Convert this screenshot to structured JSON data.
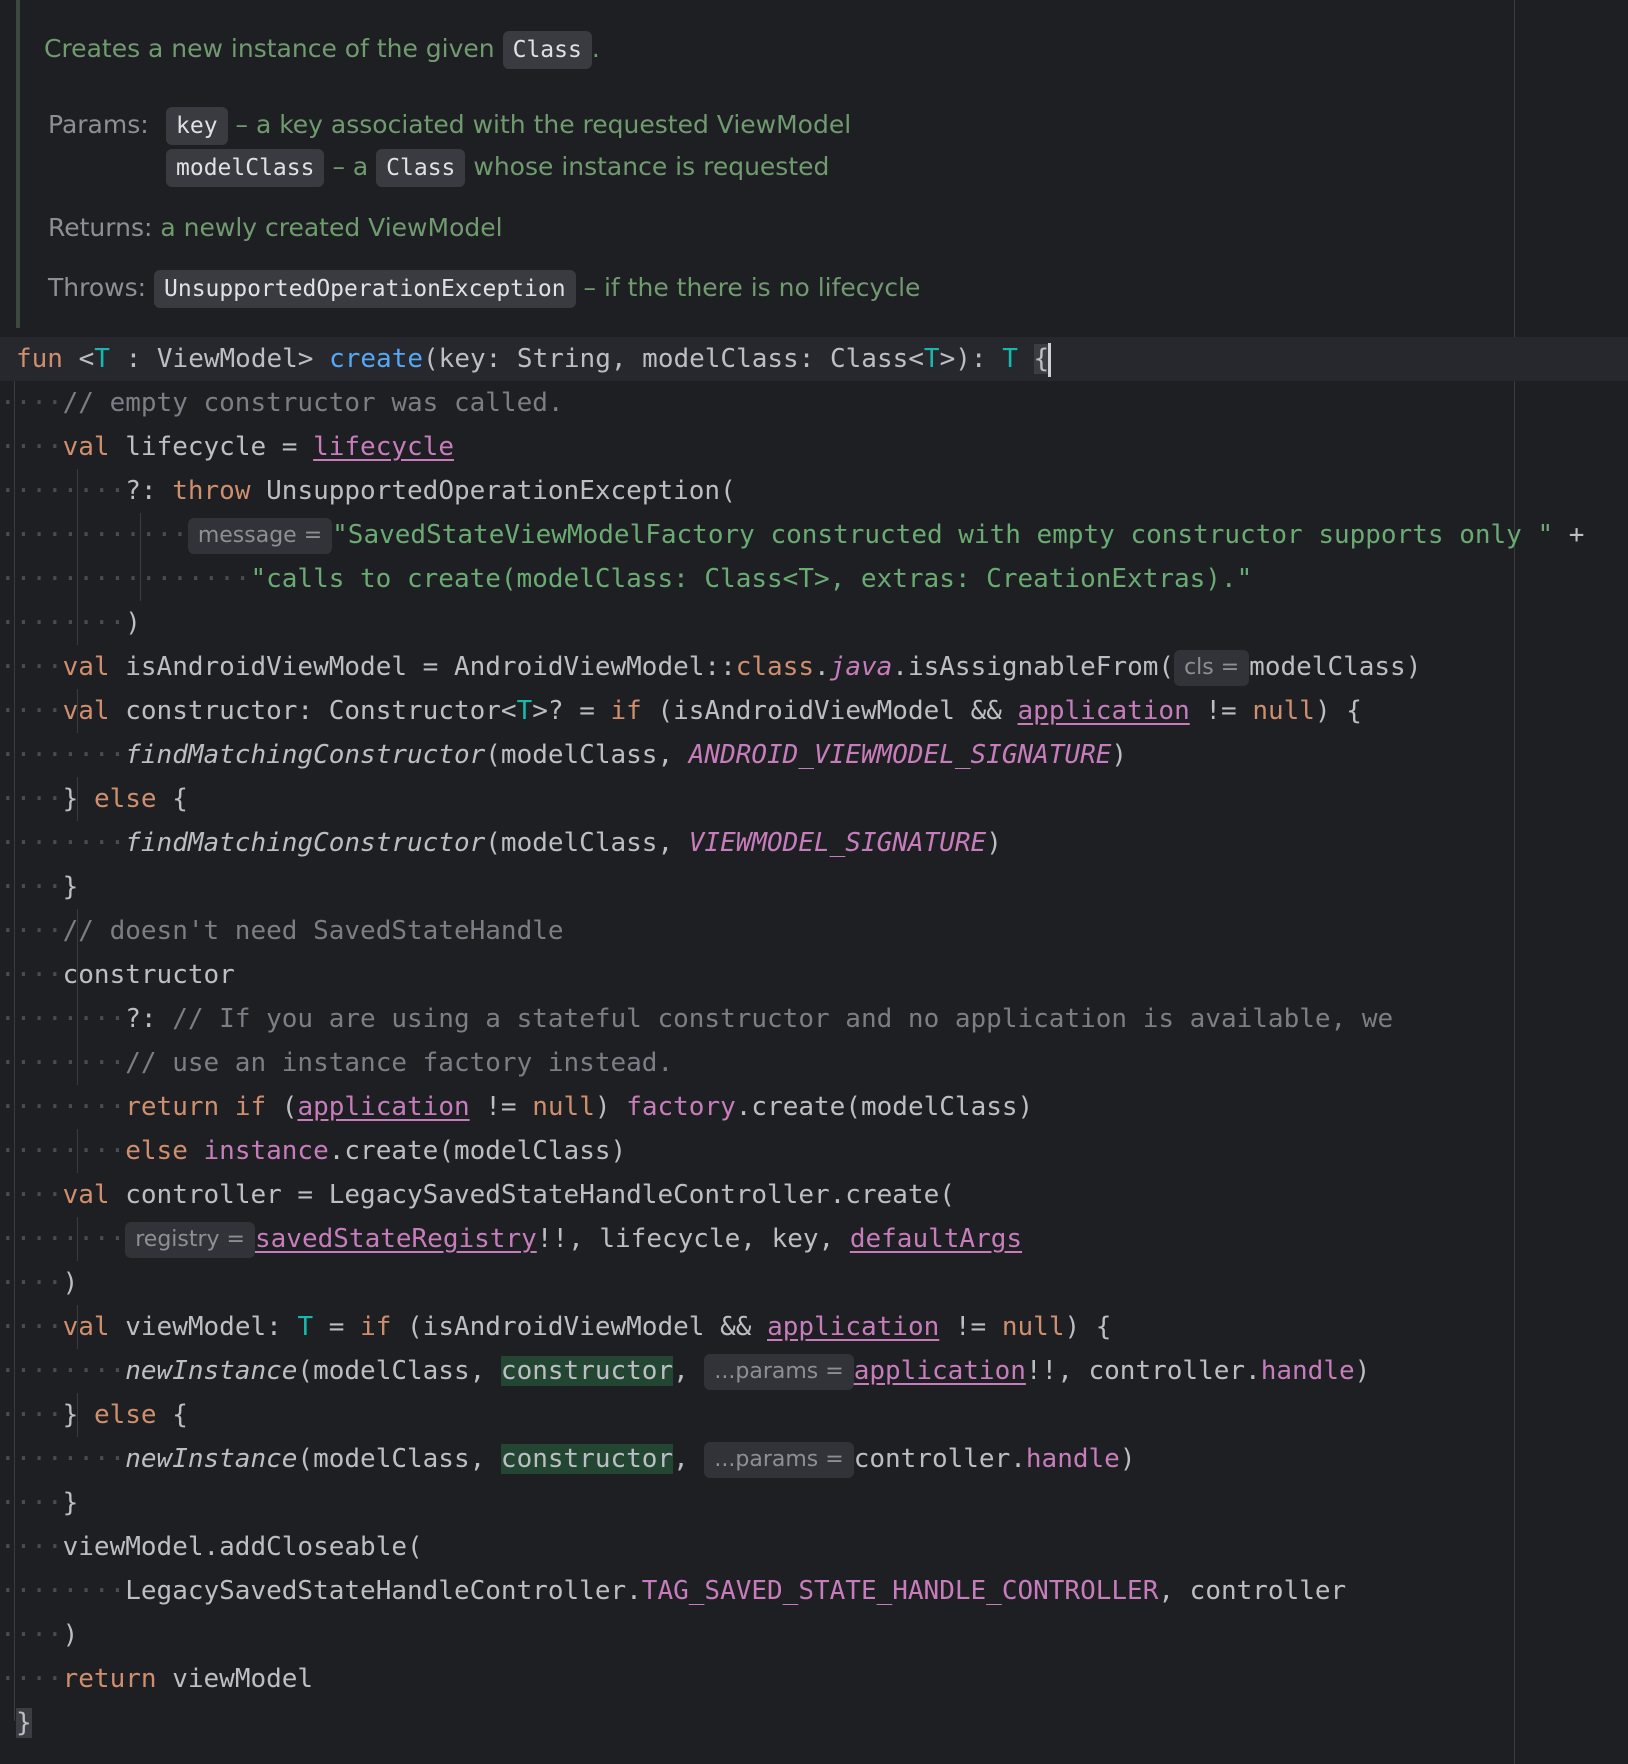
{
  "doc": {
    "summary_text": "Creates a new instance of the given",
    "summary_code": "Class",
    "summary_end": ".",
    "params_label": "Params:",
    "param1_name": "key",
    "param1_desc": "– a key associated with the requested ViewModel",
    "param2_name": "modelClass",
    "param2_mid": "– a",
    "param2_code": "Class",
    "param2_desc": "whose instance is requested",
    "returns_label": "Returns:",
    "returns_desc": "a newly created ViewModel",
    "throws_label": "Throws:",
    "throws_name": "UnsupportedOperationException",
    "throws_desc": "– if the there is no lifecycle"
  },
  "hints": {
    "message": "message =",
    "cls": "cls =",
    "registry": "registry =",
    "params": "...params ="
  },
  "code": {
    "fun": "fun",
    "sig_open": " <",
    "T": "T",
    "sig_bound": " : ViewModel> ",
    "create": "create",
    "sig_params": "(key: String, modelClass: Class<",
    "sig_close": ">): ",
    "brace_open": "{",
    "cmt_empty_ctor": "// empty constructor was called.",
    "val": "val",
    "lifecycle_decl": " lifecycle = ",
    "lifecycle_prop": "lifecycle",
    "elvis": "?: ",
    "throw": "throw",
    "unsupported_ctor": " UnsupportedOperationException(",
    "msg1": "\"SavedStateViewModelFactory constructed with empty constructor supports only \"",
    "plus": " +",
    "msg2": "\"calls to create(modelClass: Class<T>, extras: CreationExtras).\"",
    "close_paren": ")",
    "is_android_decl": " isAndroidViewModel = AndroidViewModel::",
    "class_kw": "class",
    "dot": ".",
    "java": "java",
    "assignable": ".isAssignableFrom(",
    "modelClass_close": "modelClass)",
    "ctor_decl": " constructor: Constructor<",
    "ctor_decl2": ">? = ",
    "if": "if",
    "cond_open": " (isAndroidViewModel && ",
    "application": "application",
    "neq": " != ",
    "null": "null",
    "cond_close": ") {",
    "findMatching": "findMatchingConstructor",
    "fm_args": "(modelClass, ",
    "android_sig": "ANDROID_VIEWMODEL_SIGNATURE",
    "else_open_a": "} ",
    "else": "else",
    "else_open_b": " {",
    "vm_sig": "VIEWMODEL_SIGNATURE",
    "close_brace": "}",
    "cmt_no_handle": "// doesn't need SavedStateHandle",
    "constructor": "constructor",
    "cmt_stateful1": "// If you are using a stateful constructor and no application is available, we",
    "cmt_stateful2": "// use an instance factory instead.",
    "return": "return",
    "paren_open": " (",
    "app_close": ") ",
    "factory": "factory",
    "create_call": ".create(modelClass)",
    "instance": "instance",
    "controller_decl": " controller = LegacySavedStateHandleController.create(",
    "savedStateRegistry": "savedStateRegistry",
    "ctrl_args": "!!, lifecycle, key, ",
    "defaultArgs": "defaultArgs",
    "vm_decl": " viewModel: ",
    "vm_decl2": " = ",
    "newInstance": "newInstance",
    "ni_args": "(modelClass, ",
    "comma": ",",
    "bang_ctrl": "!!, controller.",
    "handle": "handle",
    "controller_dot": "controller.",
    "add_closeable": "viewModel.addCloseable(",
    "legacy_dot": "LegacySavedStateHandleController.",
    "tag": "TAG_SAVED_STATE_HANDLE_CONTROLLER",
    "ctrl_tail": ", controller",
    "viewModel": "viewModel"
  },
  "colors": {
    "background": "#1e1f22",
    "keyword": "#cf8e6d",
    "function": "#56a8f5",
    "type_param": "#16baac",
    "string": "#6aab73",
    "property": "#c77dbb",
    "comment": "#7a7e85",
    "doc_text": "#6f9b6f"
  }
}
